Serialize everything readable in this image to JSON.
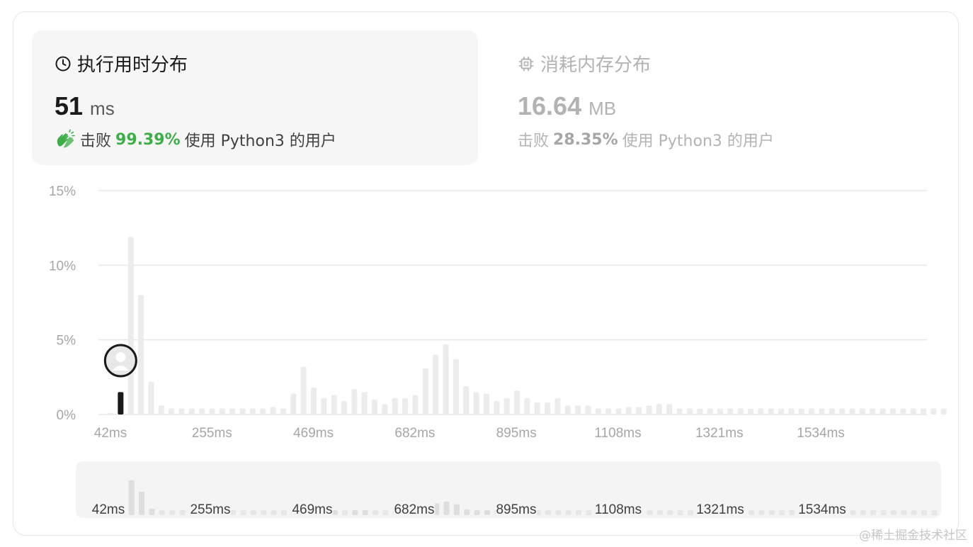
{
  "runtime_card": {
    "title": "执行用时分布",
    "icon": "clock-icon",
    "value": "51",
    "unit": "ms",
    "beats_prefix": "击败",
    "beats_pct": "99.39%",
    "beats_suffix": "使用 Python3 的用户",
    "accent": "#3fae49"
  },
  "memory_card": {
    "title": "消耗内存分布",
    "icon": "chip-icon",
    "value": "16.64",
    "unit": "MB",
    "beats_prefix": "击败",
    "beats_pct": "28.35%",
    "beats_suffix": "使用 Python3 的用户"
  },
  "chart_data": {
    "type": "bar",
    "title": "",
    "xlabel": "",
    "ylabel": "",
    "y_tick_labels": [
      "15%",
      "10%",
      "5%",
      "0%"
    ],
    "ylim": [
      0,
      15
    ],
    "x_tick_labels": [
      "42ms",
      "255ms",
      "469ms",
      "682ms",
      "895ms",
      "1108ms",
      "1321ms",
      "1534ms"
    ],
    "grid": true,
    "highlight_index": 1,
    "highlight_value": 1.5,
    "values": [
      0.1,
      1.5,
      11.9,
      8.0,
      2.2,
      0.6,
      0.4,
      0.4,
      0.4,
      0.4,
      0.4,
      0.4,
      0.4,
      0.4,
      0.4,
      0.4,
      0.5,
      0.4,
      1.4,
      3.2,
      1.8,
      1.1,
      1.3,
      0.9,
      1.7,
      1.5,
      1.0,
      0.7,
      1.1,
      1.1,
      1.3,
      3.1,
      4.0,
      4.7,
      3.7,
      1.9,
      1.5,
      1.4,
      0.9,
      1.1,
      1.6,
      1.1,
      0.8,
      0.8,
      1.1,
      0.6,
      0.6,
      0.6,
      0.4,
      0.4,
      0.4,
      0.5,
      0.5,
      0.6,
      0.7,
      0.7,
      0.4,
      0.4,
      0.4,
      0.4,
      0.4,
      0.4,
      0.4,
      0.4,
      0.4,
      0.4,
      0.4,
      0.4,
      0.4,
      0.4,
      0.4,
      0.4,
      0.4,
      0.4,
      0.4,
      0.4,
      0.4,
      0.4,
      0.4,
      0.4,
      0.4,
      0.4,
      0.4
    ]
  },
  "minimap": {
    "x_tick_labels": [
      "42ms",
      "255ms",
      "469ms",
      "682ms",
      "895ms",
      "1108ms",
      "1321ms",
      "1534ms"
    ]
  },
  "watermark": "@稀土掘金技术社区"
}
